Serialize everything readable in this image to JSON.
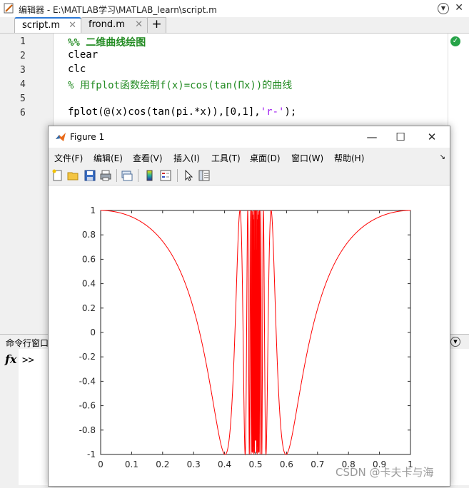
{
  "editor": {
    "title": "编辑器 - E:\\MATLAB学习\\MATLAB_learn\\script.m",
    "tabs": [
      {
        "label": "script.m",
        "close": "✕"
      },
      {
        "label": "frond.m",
        "close": "✕"
      }
    ],
    "add_tab": "+",
    "line_numbers": [
      "1",
      "2",
      "3",
      "4",
      "5",
      "6"
    ],
    "lines": {
      "l1": "%% 二维曲线绘图",
      "l2": "clear",
      "l3": "clc",
      "l4": "% 用fplot函数绘制f(x)=cos(tan(Πx))的曲线",
      "l6_a": "fplot(@(x)cos(tan(pi.*x)),[0,1],",
      "l6_b": "'r-'",
      "l6_c": ");"
    },
    "close_symbol": "✕"
  },
  "command_window": {
    "title": "命令行窗口",
    "fx": "fx",
    "prompt": ">>"
  },
  "figure": {
    "title": "Figure 1",
    "menu": [
      "文件(F)",
      "编辑(E)",
      "查看(V)",
      "插入(I)",
      "工具(T)",
      "桌面(D)",
      "窗口(W)",
      "帮助(H)"
    ],
    "window_buttons": {
      "minimize": "—",
      "maximize": "☐",
      "close": "✕"
    }
  },
  "chart_data": {
    "type": "line",
    "function": "cos(tan(pi*x))",
    "xlim": [
      0,
      1
    ],
    "ylim": [
      -1,
      1
    ],
    "xticks": [
      0,
      0.1,
      0.2,
      0.3,
      0.4,
      0.5,
      0.6,
      0.7,
      0.8,
      0.9,
      1
    ],
    "xtick_labels": [
      "0",
      "0.1",
      "0.2",
      "0.3",
      "0.4",
      "0.5",
      "0.6",
      "0.7",
      "0.8",
      "0.9",
      "1"
    ],
    "yticks": [
      -1,
      -0.8,
      -0.6,
      -0.4,
      -0.2,
      0,
      0.2,
      0.4,
      0.6,
      0.8,
      1
    ],
    "ytick_labels": [
      "-1",
      "-0.8",
      "-0.6",
      "-0.4",
      "-0.2",
      "0",
      "0.2",
      "0.4",
      "0.6",
      "0.8",
      "1"
    ],
    "series": [
      {
        "color": "#ff0000",
        "x": [
          0,
          0.05,
          0.1,
          0.15,
          0.2,
          0.25,
          0.3,
          0.35,
          0.4,
          0.45,
          0.55,
          0.6,
          0.65,
          0.7,
          0.75,
          0.8,
          0.85,
          0.9,
          0.95,
          1
        ],
        "y": [
          1,
          0.988,
          0.951,
          0.886,
          0.797,
          0.54,
          0.28,
          -0.1,
          -0.997,
          -0.97,
          -0.97,
          -0.997,
          -0.1,
          0.28,
          0.54,
          0.797,
          0.886,
          0.951,
          0.988,
          1
        ]
      }
    ],
    "title": "",
    "xlabel": "",
    "ylabel": "",
    "grid": false
  },
  "watermark": "CSDN @卡夫卡与海"
}
